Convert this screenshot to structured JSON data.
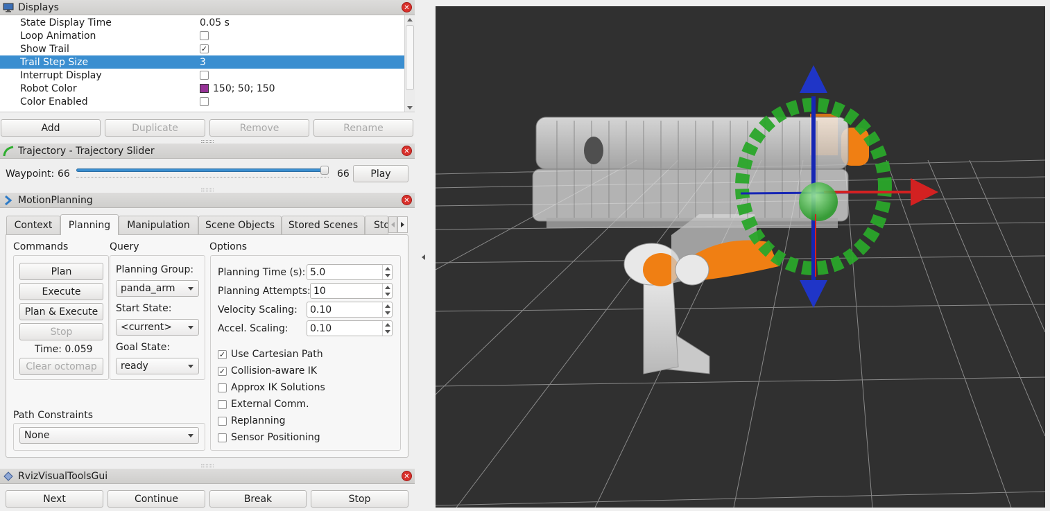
{
  "displays": {
    "title": "Displays",
    "properties": [
      {
        "name": "State Display Time",
        "value": "0.05 s",
        "type": "text"
      },
      {
        "name": "Loop Animation",
        "value": "",
        "type": "checkbox",
        "checked": false
      },
      {
        "name": "Show Trail",
        "value": "",
        "type": "checkbox",
        "checked": true
      },
      {
        "name": "Trail Step Size",
        "value": "3",
        "type": "text",
        "selected": true
      },
      {
        "name": "Interrupt Display",
        "value": "",
        "type": "checkbox",
        "checked": false
      },
      {
        "name": "Robot Color",
        "value": "150; 50; 150",
        "type": "color",
        "color": "#963296"
      },
      {
        "name": "Color Enabled",
        "value": "",
        "type": "checkbox",
        "checked": false
      }
    ],
    "buttons": {
      "add": "Add",
      "duplicate": "Duplicate",
      "remove": "Remove",
      "rename": "Rename"
    }
  },
  "trajectory": {
    "title": "Trajectory - Trajectory Slider",
    "waypoint_label": "Waypoint:",
    "waypoint_min": "66",
    "waypoint_max": "66",
    "slider_fraction": 1.0,
    "play_label": "Play"
  },
  "motion_planning": {
    "title": "MotionPlanning",
    "tabs": [
      "Context",
      "Planning",
      "Manipulation",
      "Scene Objects",
      "Stored Scenes",
      "Sto"
    ],
    "active_tab": "Planning",
    "commands": {
      "heading": "Commands",
      "plan": "Plan",
      "execute": "Execute",
      "plan_execute": "Plan & Execute",
      "stop": "Stop",
      "time": "Time: 0.059",
      "clear_octomap": "Clear octomap"
    },
    "query": {
      "heading": "Query",
      "planning_group_label": "Planning Group:",
      "planning_group": "panda_arm",
      "start_state_label": "Start State:",
      "start_state": "<current>",
      "goal_state_label": "Goal State:",
      "goal_state": "ready"
    },
    "options": {
      "heading": "Options",
      "planning_time_label": "Planning Time (s):",
      "planning_time": "5.0",
      "planning_attempts_label": "Planning Attempts:",
      "planning_attempts": "10",
      "velocity_scaling_label": "Velocity Scaling:",
      "velocity_scaling": "0.10",
      "accel_scaling_label": "Accel. Scaling:",
      "accel_scaling": "0.10",
      "checks": [
        {
          "label": "Use Cartesian Path",
          "checked": true
        },
        {
          "label": "Collision-aware IK",
          "checked": true
        },
        {
          "label": "Approx IK Solutions",
          "checked": false
        },
        {
          "label": "External Comm.",
          "checked": false
        },
        {
          "label": "Replanning",
          "checked": false
        },
        {
          "label": "Sensor Positioning",
          "checked": false
        }
      ]
    },
    "path_constraints": {
      "heading": "Path Constraints",
      "value": "None"
    }
  },
  "rviz_tools": {
    "title": "RvizVisualToolsGui",
    "next": "Next",
    "continue": "Continue",
    "break": "Break",
    "stop": "Stop"
  },
  "viewport": {
    "background": "#303030",
    "grid_color": "#a0a0a0",
    "robot_accent": "#f07f13",
    "axis_colors": {
      "x": "#d32121",
      "y": "#1fa31f",
      "z": "#1626b4"
    }
  }
}
